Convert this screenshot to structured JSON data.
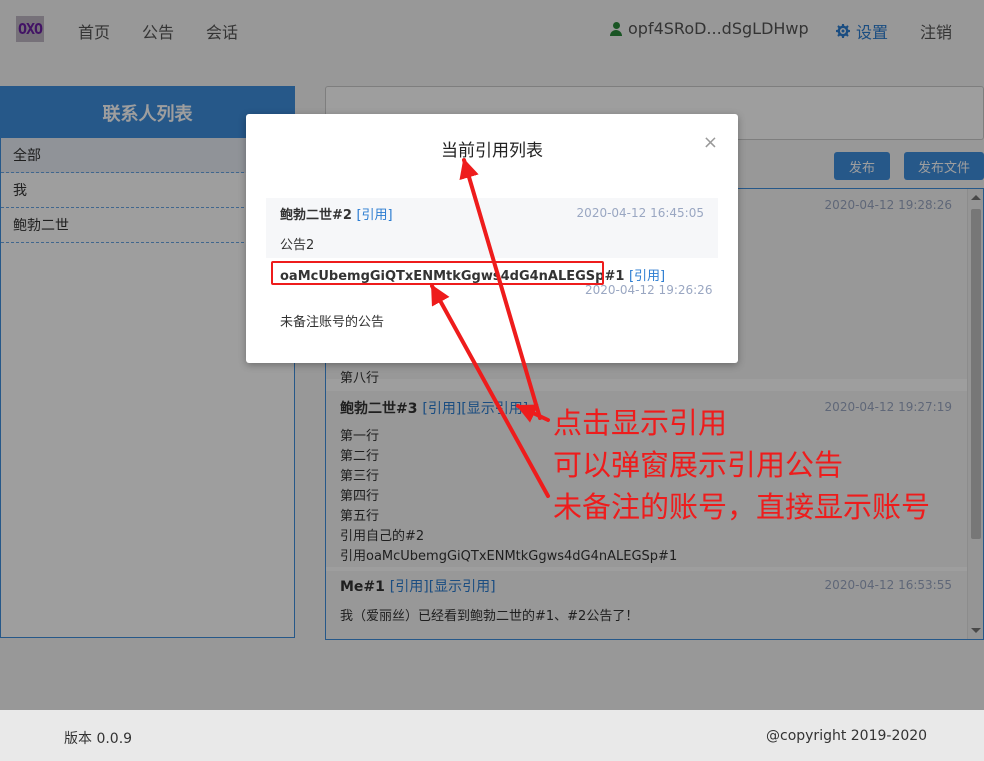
{
  "nav": {
    "logo": "OXO",
    "links": [
      "首页",
      "公告",
      "会话"
    ],
    "user": "opf4SRoD...dSgLDHwp",
    "settings": "设置",
    "logout": "注销"
  },
  "contacts": {
    "title": "联系人列表",
    "items": [
      "全部",
      "我",
      "鲍勃二世"
    ]
  },
  "actions": {
    "publish": "发布",
    "publish_file": "发布文件"
  },
  "messages": [
    {
      "time": "2020-04-12 19:28:26"
    },
    {
      "line": "第八行"
    },
    {
      "author": "鲍勃二世#3",
      "links": [
        "[引用]",
        "[显示引用]"
      ],
      "time": "2020-04-12 19:27:19",
      "lines": [
        "第一行",
        "第二行",
        "第三行",
        "第四行",
        "第五行",
        "引用自己的#2",
        "引用oaMcUbemgGiQTxENMtkGgws4dG4nALEGSp#1"
      ]
    },
    {
      "author": "Me#1",
      "links": [
        "[引用]",
        "[显示引用]"
      ],
      "time": "2020-04-12 16:53:55",
      "lines": [
        "我（爱丽丝）已经看到鲍勃二世的#1、#2公告了！"
      ]
    }
  ],
  "modal": {
    "title": "当前引用列表",
    "close": "×",
    "quotes": [
      {
        "author": "鲍勃二世#2",
        "link": "[引用]",
        "time": "2020-04-12 16:45:05",
        "body": "公告2"
      },
      {
        "author": "oaMcUbemgGiQTxENMtkGgws4dG4nALEGSp#1",
        "link": "[引用]",
        "time": "2020-04-12 19:26:26",
        "body": "未备注账号的公告"
      }
    ]
  },
  "annotations": {
    "lines": [
      "点击显示引用",
      "可以弹窗展示引用公告",
      "未备注的账号，直接显示账号"
    ],
    "color": "#ee1c1c"
  },
  "footer": {
    "version": "版本 0.0.9",
    "copyright": "@copyright 2019-2020"
  }
}
